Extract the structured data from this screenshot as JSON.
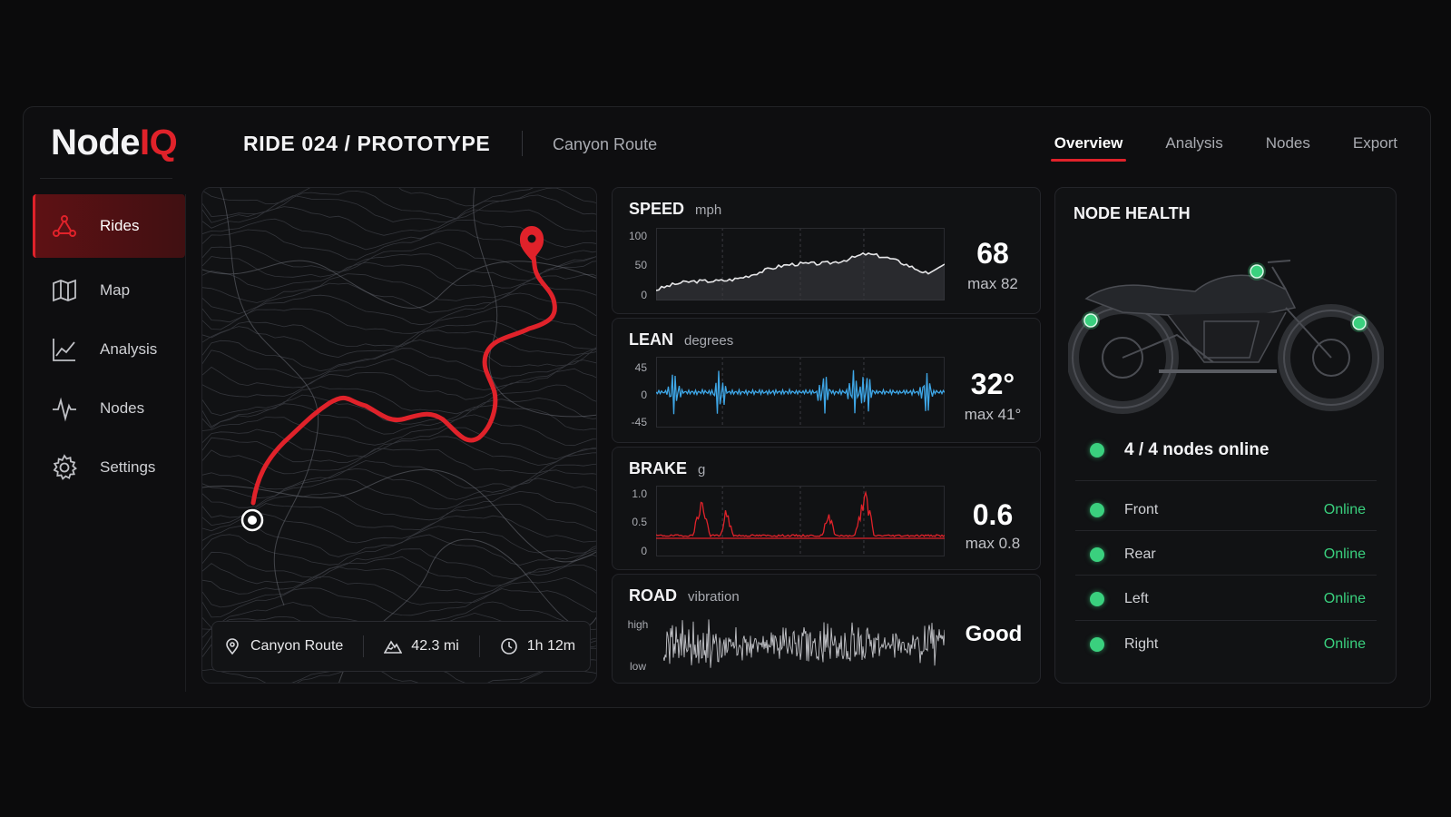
{
  "header": {
    "logo_main": "Node",
    "logo_accent": "IQ",
    "ride_title": "RIDE 024 / PROTOTYPE",
    "route_title": "Canyon Route",
    "tabs": [
      {
        "label": "Overview",
        "active": true
      },
      {
        "label": "Analysis",
        "active": false
      },
      {
        "label": "Nodes",
        "active": false
      },
      {
        "label": "Export",
        "active": false
      }
    ]
  },
  "sidebar": {
    "items": [
      {
        "label": "Rides",
        "icon": "route-icon",
        "active": true
      },
      {
        "label": "Map",
        "icon": "map-icon",
        "active": false
      },
      {
        "label": "Analysis",
        "icon": "chart-line-icon",
        "active": false
      },
      {
        "label": "Nodes",
        "icon": "pulse-icon",
        "active": false
      },
      {
        "label": "Settings",
        "icon": "gear-icon",
        "active": false
      }
    ]
  },
  "map": {
    "route_name": "Canyon Route",
    "distance": "42.3 mi",
    "duration": "1h 12m",
    "route_color": "#e0222a"
  },
  "metrics": {
    "speed": {
      "title": "SPEED",
      "unit": "mph",
      "ticks": [
        "100",
        "50",
        "0"
      ],
      "value": "68",
      "max": "max 82"
    },
    "lean": {
      "title": "LEAN",
      "unit": "degrees",
      "ticks": [
        "45",
        "0",
        "-45"
      ],
      "value": "32°",
      "max": "max 41°",
      "color": "#3ea6e6"
    },
    "brake": {
      "title": "BRAKE",
      "unit": "g",
      "ticks": [
        "1.0",
        "0.5",
        "0"
      ],
      "value": "0.6",
      "max": "max 0.8",
      "color": "#e0222a"
    },
    "road": {
      "title": "ROAD",
      "unit": "vibration",
      "ticks": [
        "high",
        "low"
      ],
      "value": "Good"
    }
  },
  "node_health": {
    "title": "NODE HEALTH",
    "summary": "4 / 4 nodes online",
    "nodes": [
      {
        "name": "Front",
        "status": "Online"
      },
      {
        "name": "Rear",
        "status": "Online"
      },
      {
        "name": "Left",
        "status": "Online"
      },
      {
        "name": "Right",
        "status": "Online"
      }
    ],
    "online_color": "#3ad07e"
  }
}
